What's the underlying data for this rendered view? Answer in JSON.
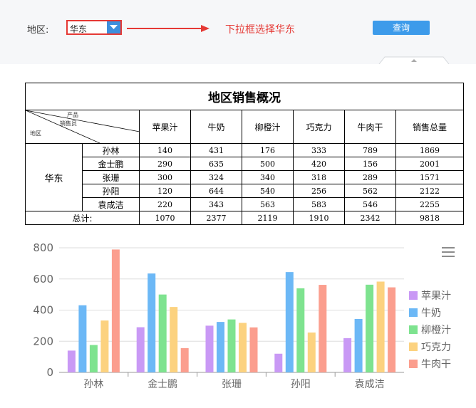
{
  "filter": {
    "label": "地区:",
    "selected": "华东",
    "hint": "下拉框选择华东",
    "query_label": "查询"
  },
  "report": {
    "title": "地区销售概况",
    "corner": {
      "product": "产品",
      "salesperson": "销售员",
      "region": "地区"
    },
    "columns": [
      "苹果汁",
      "牛奶",
      "柳橙汁",
      "巧克力",
      "牛肉干",
      "销售总量"
    ],
    "region": "华东",
    "rows": [
      {
        "name": "孙林",
        "values": [
          "140",
          "431",
          "176",
          "333",
          "789",
          "1869"
        ]
      },
      {
        "name": "金士鹏",
        "values": [
          "290",
          "635",
          "500",
          "420",
          "156",
          "2001"
        ]
      },
      {
        "name": "张珊",
        "values": [
          "300",
          "324",
          "340",
          "318",
          "289",
          "1571"
        ]
      },
      {
        "name": "孙阳",
        "values": [
          "120",
          "644",
          "540",
          "256",
          "562",
          "2122"
        ]
      },
      {
        "name": "袁成洁",
        "values": [
          "220",
          "343",
          "563",
          "583",
          "546",
          "2255"
        ]
      }
    ],
    "total_label": "总计:",
    "totals": [
      "1070",
      "2377",
      "2119",
      "1910",
      "2342",
      "9818"
    ]
  },
  "chart_data": {
    "type": "bar",
    "categories": [
      "孙林",
      "金士鹏",
      "张珊",
      "孙阳",
      "袁成洁"
    ],
    "series": [
      {
        "name": "苹果汁",
        "color": "#c999f5",
        "values": [
          140,
          290,
          300,
          120,
          220
        ]
      },
      {
        "name": "牛奶",
        "color": "#6cb8f6",
        "values": [
          431,
          635,
          324,
          644,
          343
        ]
      },
      {
        "name": "柳橙汁",
        "color": "#7ee38f",
        "values": [
          176,
          500,
          340,
          540,
          563
        ]
      },
      {
        "name": "巧克力",
        "color": "#fcd27f",
        "values": [
          333,
          420,
          318,
          256,
          583
        ]
      },
      {
        "name": "牛肉干",
        "color": "#fb9e8e",
        "values": [
          789,
          156,
          289,
          562,
          546
        ]
      }
    ],
    "ylim": [
      0,
      800
    ],
    "yticks": [
      "0",
      "200",
      "400",
      "600",
      "800"
    ],
    "grid": true,
    "legend": "right"
  }
}
